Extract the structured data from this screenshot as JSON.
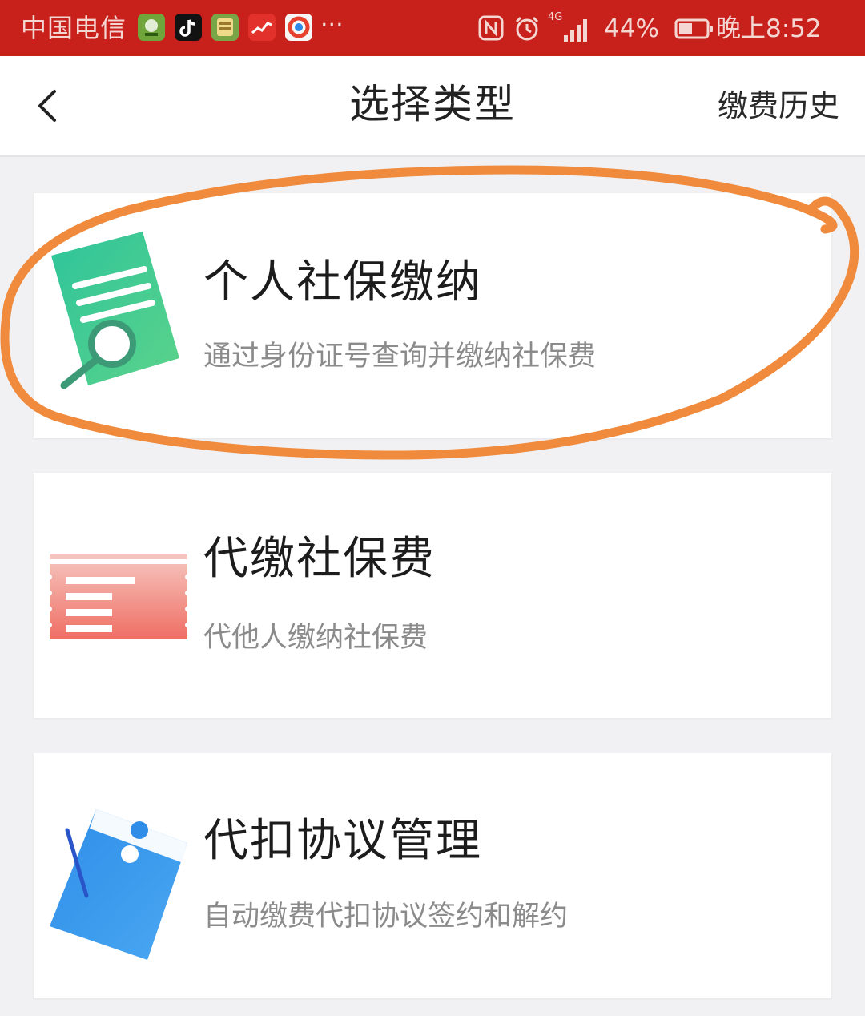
{
  "status_bar": {
    "carrier": "中国电信",
    "more": "···",
    "signal_label": "4G",
    "battery": "44%",
    "time": "晚上8:52"
  },
  "nav": {
    "title": "选择类型",
    "history": "缴费历史"
  },
  "cards": [
    {
      "title": "个人社保缴纳",
      "subtitle": "通过身份证号查询并缴纳社保费",
      "icon": "document-search-icon",
      "accent": "#3dc79a"
    },
    {
      "title": "代缴社保费",
      "subtitle": "代他人缴纳社保费",
      "icon": "ticket-icon",
      "accent": "#f17c72"
    },
    {
      "title": "代扣协议管理",
      "subtitle": "自动缴费代扣协议签约和解约",
      "icon": "agreement-folder-icon",
      "accent": "#3a9bef"
    }
  ],
  "colors": {
    "status_bar": "#c8201b",
    "background": "#f1f1f3",
    "annotation": "#f08a3c"
  }
}
